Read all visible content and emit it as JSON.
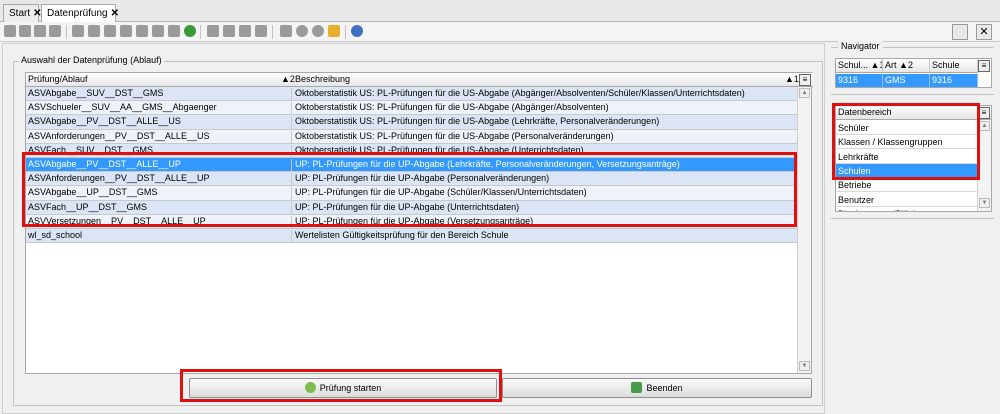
{
  "tabs": [
    {
      "label": "Start",
      "close": "✕"
    },
    {
      "label": "Datenprüfung",
      "close": "✕"
    }
  ],
  "toolbar": {
    "icons": [
      "save-icon",
      "save-all-icon",
      "undo-icon",
      "delete-icon",
      "cut-page-icon",
      "first-icon",
      "prev-page-icon",
      "prev-icon",
      "next-icon",
      "next-page-icon",
      "last-icon",
      "refresh-icon",
      "link-icon",
      "scissors-icon",
      "copy-icon",
      "paste-icon",
      "print-icon",
      "stamp-icon",
      "bulb-icon",
      "brush-icon",
      "help-icon"
    ]
  },
  "panel": {
    "group_label": "Auswahl der Datenprüfung (Ablauf)",
    "columns": [
      {
        "label": "Prüfung/Ablauf",
        "sort": "▲2"
      },
      {
        "label": "Beschreibung",
        "sort": "▲1"
      }
    ],
    "rows": [
      {
        "name": "ASVAbgabe__SUV__DST__GMS",
        "desc": "Oktoberstatistik US: PL-Prüfungen für die US-Abgabe (Abgänger/Absolventen/Schüler/Klassen/Unterrichtsdaten)"
      },
      {
        "name": "ASVSchueler__SUV__AA__GMS__Abgaenger",
        "desc": "Oktoberstatistik US: PL-Prüfungen für die US-Abgabe (Abgänger/Absolventen)"
      },
      {
        "name": "ASVAbgabe__PV__DST__ALLE__US",
        "desc": "Oktoberstatistik US: PL-Prüfungen für die US-Abgabe (Lehrkräfte, Personalveränderungen)"
      },
      {
        "name": "ASVAnforderungen__PV__DST__ALLE__US",
        "desc": "Oktoberstatistik US: PL-Prüfungen für die US-Abgabe (Personalveränderungen)"
      },
      {
        "name": "ASVFach__SUV__DST__GMS",
        "desc": "Oktoberstatistik US: PL-Prüfungen für die US-Abgabe (Unterrichtsdaten)"
      },
      {
        "name": "ASVAbgabe__PV__DST__ALLE__UP",
        "desc": "UP: PL-Prüfungen für die UP-Abgabe (Lehrkräfte, Personalveränderungen, Versetzungsanträge)"
      },
      {
        "name": "ASVAnforderungen__PV__DST__ALLE__UP",
        "desc": "UP: PL-Prüfungen für die UP-Abgabe (Personalveränderungen)"
      },
      {
        "name": "ASVAbgabe__UP__DST__GMS",
        "desc": "UP: PL-Prüfungen für die UP-Abgabe (Schüler/Klassen/Unterrichtsdaten)"
      },
      {
        "name": "ASVFach__UP__DST__GMS",
        "desc": "UP: PL-Prüfungen für die UP-Abgabe (Unterrichtsdaten)"
      },
      {
        "name": "ASVVersetzungen__PV__DST__ALLE__UP",
        "desc": "UP: PL-Prüfungen für die UP-Abgabe (Versetzungsanträge)"
      },
      {
        "name": "wl_sd_school",
        "desc": "Wertelisten Gültigkeitsprüfung für den Bereich Schule"
      }
    ],
    "selected_row": 5,
    "start_button": "Prüfung starten",
    "end_button": "Beenden"
  },
  "navigator": {
    "label": "Navigator",
    "columns": [
      {
        "label": "Schul...",
        "sort": "▲1"
      },
      {
        "label": "Art",
        "sort": "▲2"
      },
      {
        "label": "Schule",
        "sort": ""
      }
    ],
    "row": [
      "9316",
      "GMS",
      "9316"
    ]
  },
  "datenbereich": {
    "header": "Datenbereich",
    "items": [
      "Schüler",
      "Klassen / Klassengruppen",
      "Lehrkräfte",
      "Schulen",
      "Betriebe",
      "Benutzer",
      "Blockgruppen/Blöcke"
    ],
    "selected": "Schulen"
  },
  "colors": {
    "selection": "#3399ff",
    "highlight": "#e01010",
    "row_alt": "#dbe5f5"
  }
}
